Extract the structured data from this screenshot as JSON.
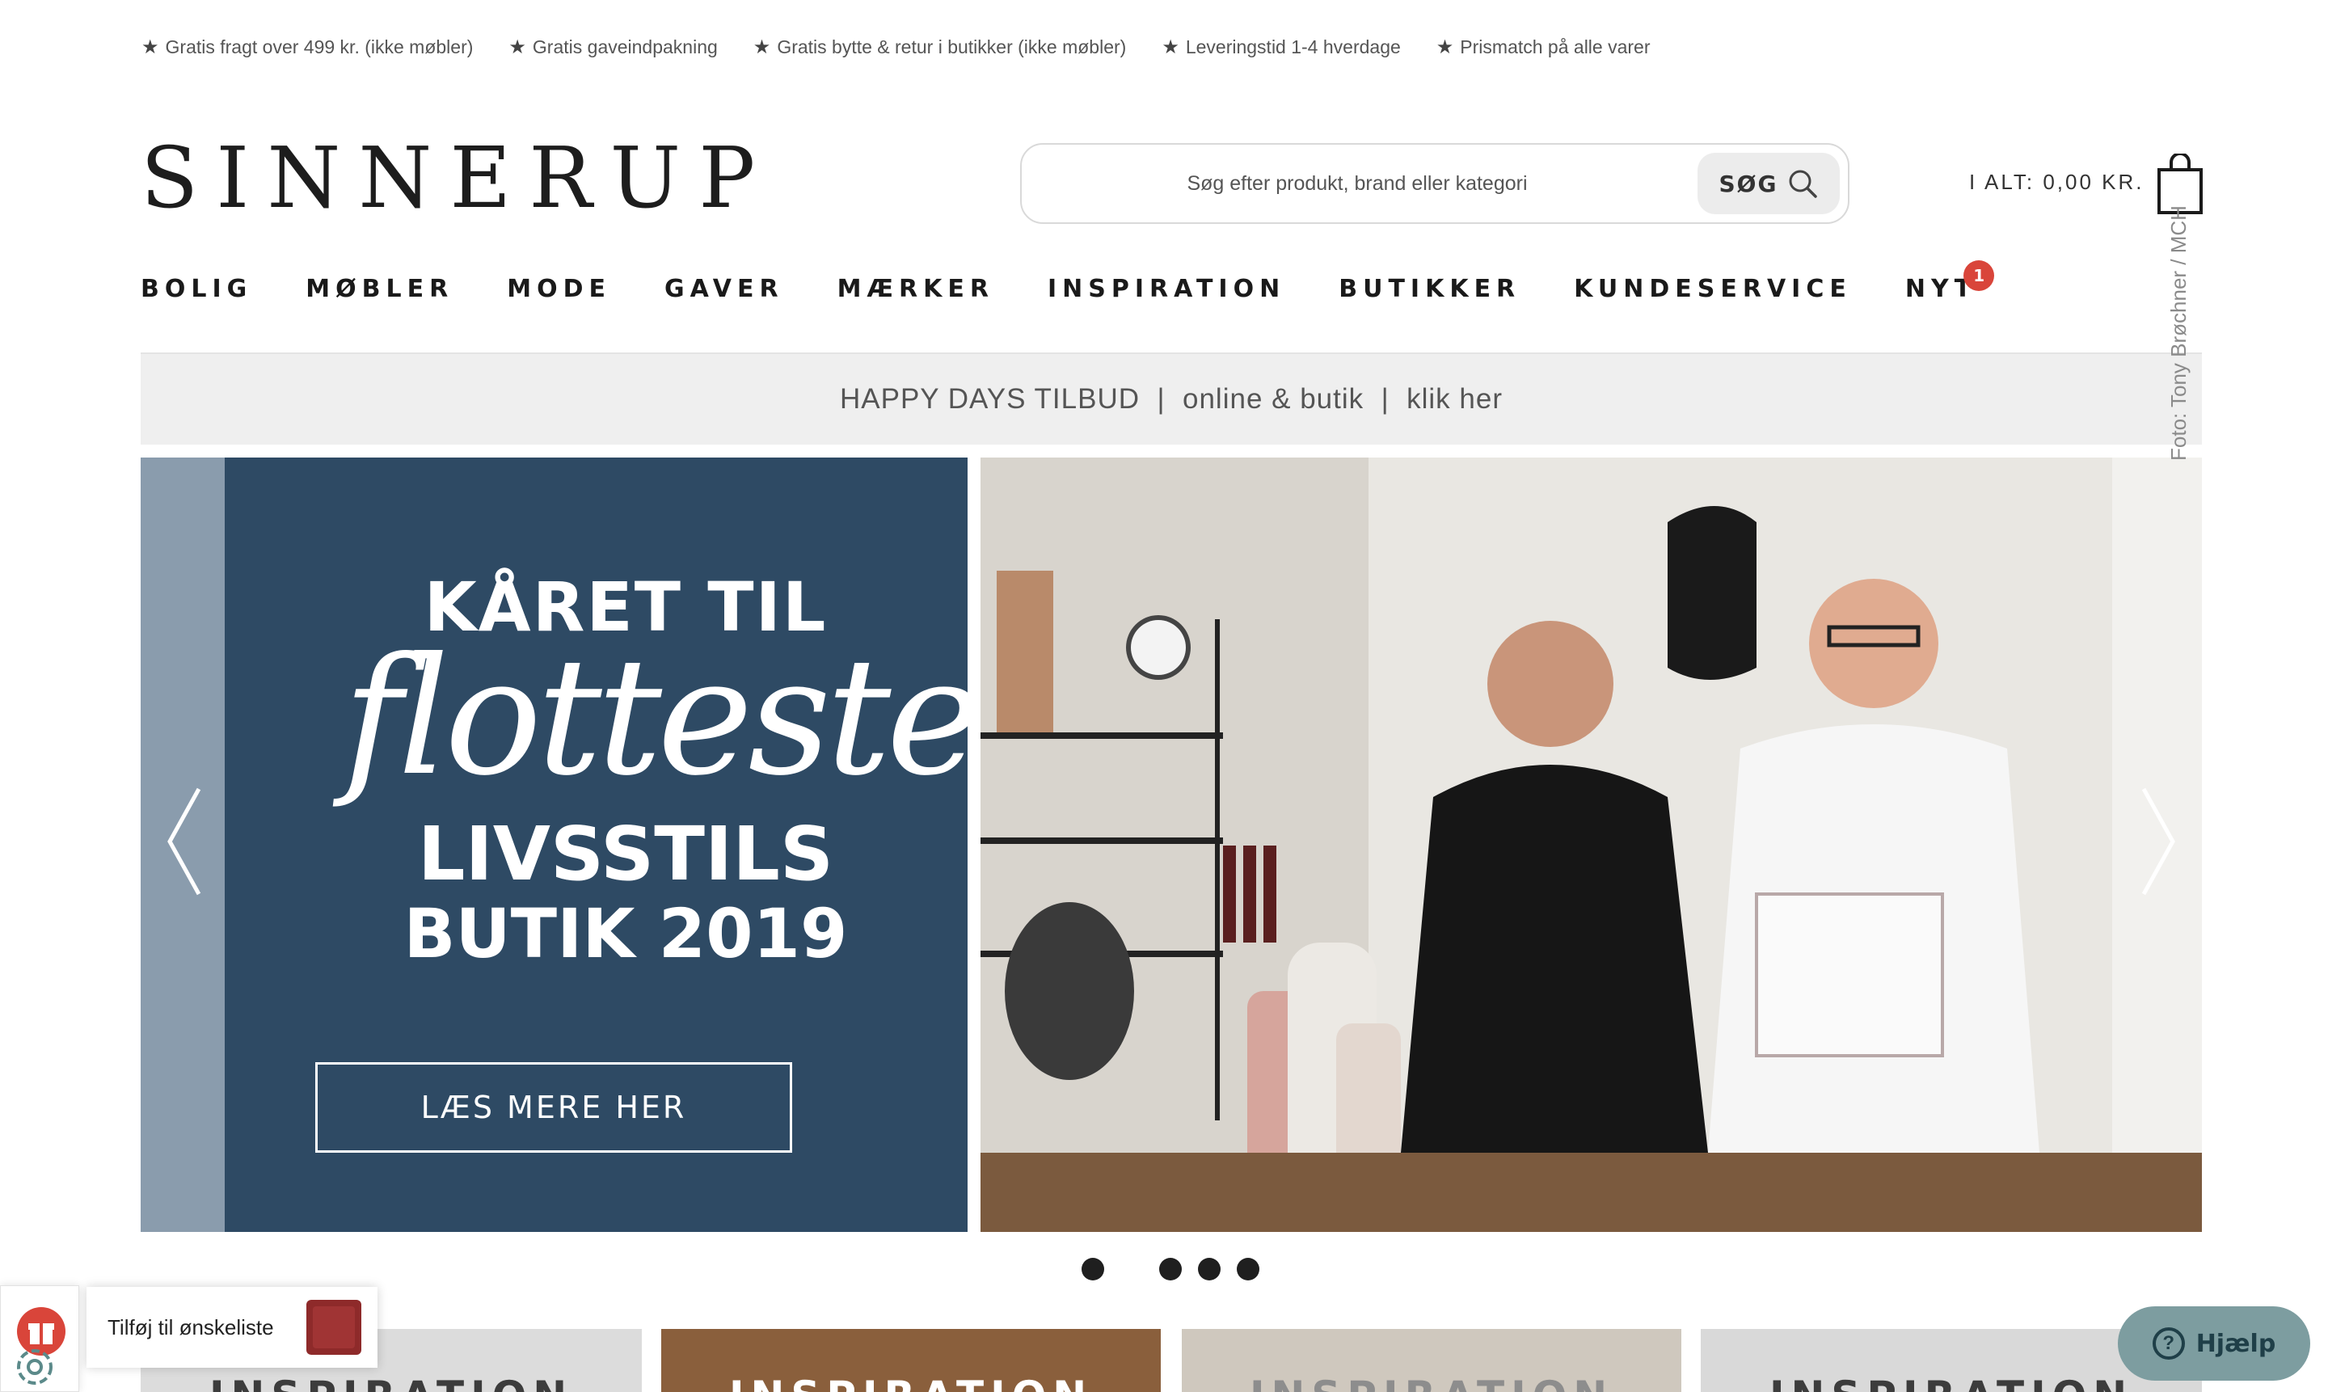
{
  "usp": [
    {
      "icon": "star-icon",
      "text": "Gratis fragt over 499 kr. (ikke møbler)"
    },
    {
      "icon": "star-icon",
      "text": "Gratis gaveindpakning"
    },
    {
      "icon": "star-icon",
      "text": "Gratis bytte & retur i butikker (ikke møbler)"
    },
    {
      "icon": "star-icon",
      "text": "Leveringstid 1-4 hverdage"
    },
    {
      "icon": "star-icon",
      "text": "Prismatch på alle varer"
    }
  ],
  "header": {
    "logo": "SINNERUP",
    "search_placeholder": "Søg efter produkt, brand eller kategori",
    "search_button": "SØG",
    "cart_total": "I ALT: 0,00 KR."
  },
  "nav": {
    "items": [
      "BOLIG",
      "MØBLER",
      "MODE",
      "GAVER",
      "MÆRKER",
      "INSPIRATION",
      "BUTIKKER",
      "KUNDESERVICE",
      "NYT"
    ],
    "new_badge": "1"
  },
  "promo": {
    "text": "HAPPY DAYS TILBUD  |  online & butik  |  klik her"
  },
  "hero": {
    "line1": "KÅRET TIL",
    "script": "flotteste",
    "line2": "LIVSSTILS",
    "line3": "BUTIK 2019",
    "cta": "LÆS MERE HER",
    "credit": "Foto: Tony Brøchner / MCH"
  },
  "tiles": [
    "INSPIRATION",
    "INSPIRATION",
    "INSPIRATION",
    "INSPIRATION"
  ],
  "wishlist": {
    "text": "Tilføj til ønskeliste"
  },
  "help": {
    "label": "Hjælp"
  },
  "colors": {
    "hero_blue": "#2e4a64",
    "badge_red": "#d9453a",
    "help_teal": "#7d9da0"
  }
}
